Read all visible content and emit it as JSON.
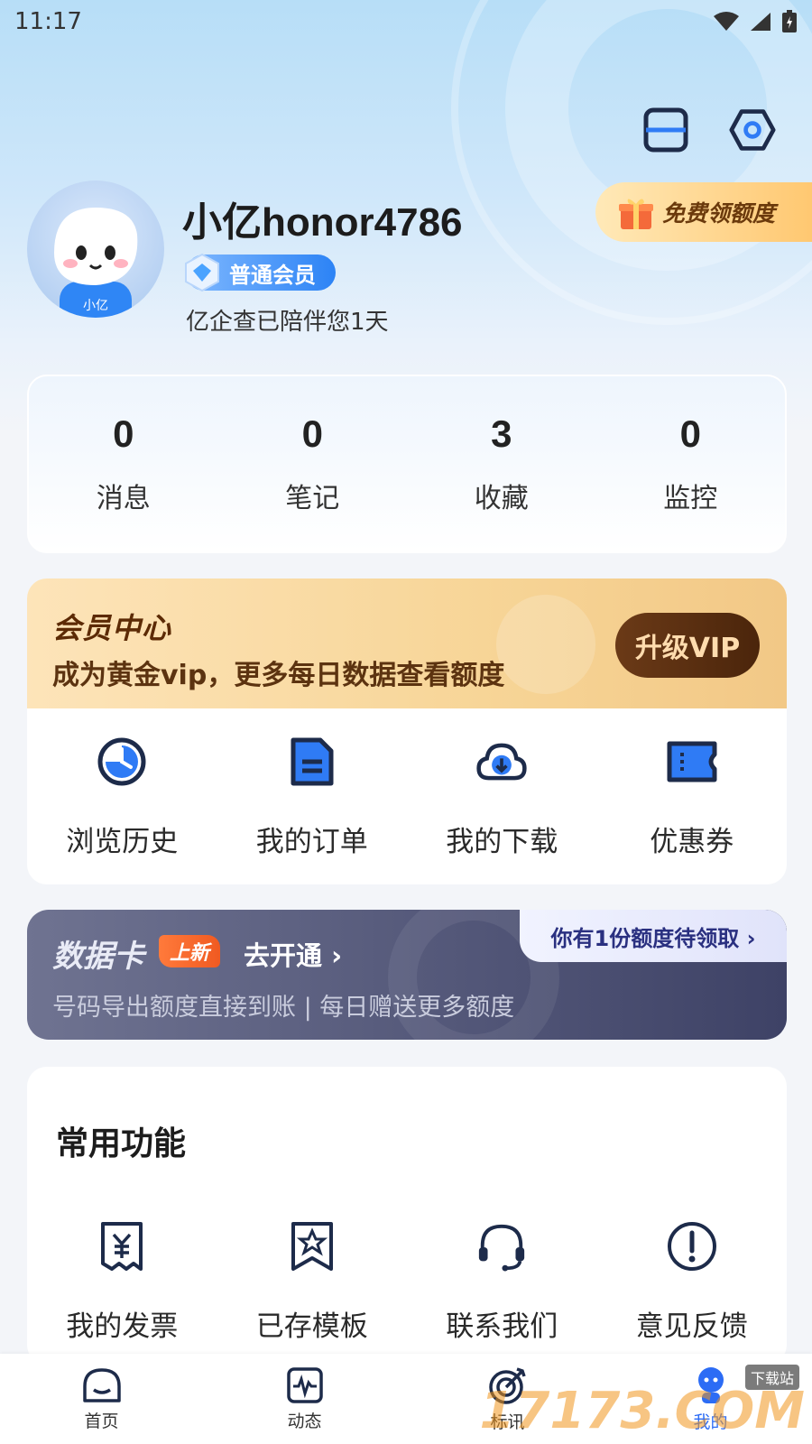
{
  "status_bar": {
    "time": "11:17"
  },
  "profile": {
    "username": "小亿honor4786",
    "member_level": "普通会员",
    "accompany_text": "亿企查已陪伴您1天",
    "avatar_caption": "小亿"
  },
  "free_quota_label": "免费领额度",
  "stats": [
    {
      "value": "0",
      "label": "消息"
    },
    {
      "value": "0",
      "label": "笔记"
    },
    {
      "value": "3",
      "label": "收藏"
    },
    {
      "value": "0",
      "label": "监控"
    }
  ],
  "vip": {
    "title": "会员中心",
    "subtitle": "成为黄金vip，更多每日数据查看额度",
    "button": "升级VIP"
  },
  "quick_links": [
    {
      "label": "浏览历史",
      "icon": "clock-icon"
    },
    {
      "label": "我的订单",
      "icon": "order-icon"
    },
    {
      "label": "我的下载",
      "icon": "cloud-download-icon"
    },
    {
      "label": "优惠券",
      "icon": "coupon-icon"
    }
  ],
  "data_card": {
    "title": "数据卡",
    "tag": "上新",
    "open_label": "去开通 ›",
    "subtitle": "号码导出额度直接到账 | 每日赠送更多额度",
    "claim_label": "你有1份额度待领取 ›"
  },
  "common": {
    "title": "常用功能",
    "items": [
      {
        "label": "我的发票",
        "icon": "invoice-icon"
      },
      {
        "label": "已存模板",
        "icon": "template-icon"
      },
      {
        "label": "联系我们",
        "icon": "headset-icon"
      },
      {
        "label": "意见反馈",
        "icon": "feedback-icon"
      }
    ]
  },
  "tabbar": [
    {
      "label": "首页",
      "icon": "home-icon"
    },
    {
      "label": "动态",
      "icon": "activity-icon"
    },
    {
      "label": "标讯",
      "icon": "target-icon"
    },
    {
      "label": "我的",
      "icon": "profile-icon"
    }
  ],
  "colors": {
    "accent": "#2c6cf5",
    "icon_dark": "#1d2b4a",
    "icon_blue": "#2f7bf5",
    "vip_brown": "#5c2a05"
  },
  "watermark": {
    "text": "17173.COM",
    "badge": "下载站"
  }
}
